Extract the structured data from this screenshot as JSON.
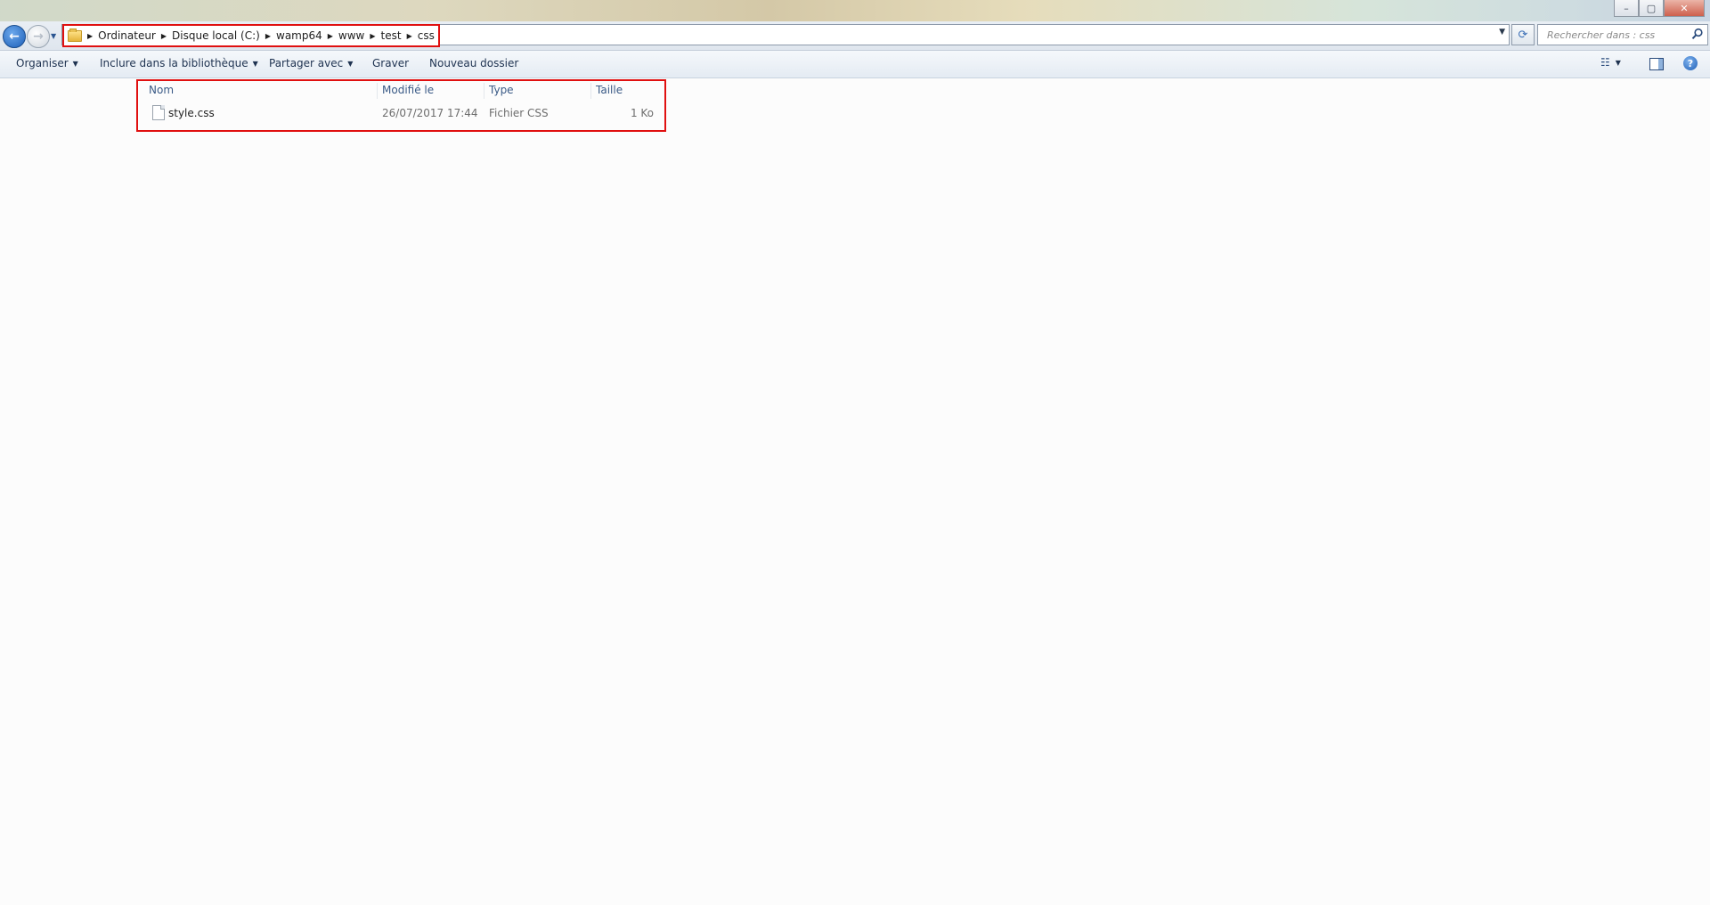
{
  "titlebar": {
    "minimize_label": "–",
    "maximize_label": "▢",
    "close_label": "✕"
  },
  "nav": {
    "back_icon": "back-arrow-icon",
    "forward_icon": "forward-arrow-icon",
    "back_glyph": "←",
    "forward_glyph": "→",
    "recent_glyph": "▼"
  },
  "address": {
    "path_separator": "▶",
    "crumbs": [
      "Ordinateur",
      "Disque local (C:)",
      "wamp64",
      "www",
      "test",
      "css"
    ],
    "dropdown_glyph": "▼",
    "refresh_glyph": "⟳"
  },
  "search": {
    "placeholder": "Rechercher dans : css"
  },
  "commandbar": {
    "organize_label": "Organiser",
    "include_label": "Inclure dans la bibliothèque",
    "share_label": "Partager avec",
    "burn_label": "Graver",
    "new_folder_label": "Nouveau dossier",
    "caret": "▼",
    "view_glyph": "☷",
    "help_glyph": "?"
  },
  "filelist": {
    "columns": {
      "name": "Nom",
      "modified": "Modifié le",
      "type": "Type",
      "size": "Taille"
    },
    "files": [
      {
        "name": "style.css",
        "modified": "26/07/2017 17:44",
        "type": "Fichier CSS",
        "size": "1 Ko"
      }
    ]
  },
  "colors": {
    "highlight_border": "#e01010",
    "toolbar_text": "#1e3250",
    "header_text": "#3a5a86"
  }
}
